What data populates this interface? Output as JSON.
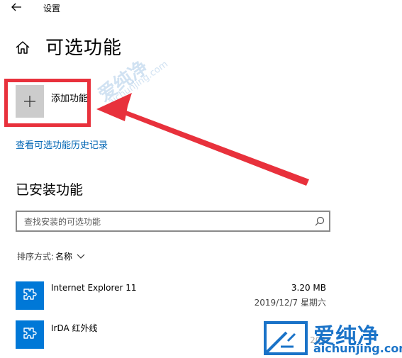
{
  "window": {
    "title": "设置"
  },
  "page": {
    "title": "可选功能"
  },
  "add_feature": {
    "label": "添加功能"
  },
  "history_link": {
    "label": "查看可选功能历史记录"
  },
  "installed": {
    "title": "已安装功能",
    "search_placeholder": "查找安装的可选功能",
    "sort_prefix": "排序方式:",
    "sort_value": "名称",
    "items": [
      {
        "name": "Internet Explorer 11",
        "size": "3.20 MB",
        "date": "2019/12/7 星期六",
        "icon": "puzzle-icon"
      },
      {
        "name": "IrDA 红外线",
        "size": "",
        "date": "202",
        "icon": "puzzle-icon"
      }
    ]
  },
  "watermark": {
    "text": "爱纯净",
    "url": "aichunjing.com"
  },
  "colors": {
    "accent": "#0078d7",
    "link": "#0066b4",
    "annotation_red": "#e8313c",
    "tile_gray": "#cccccc"
  }
}
